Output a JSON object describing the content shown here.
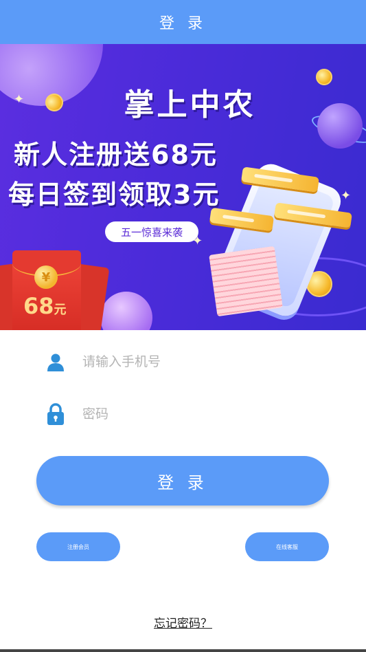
{
  "header": {
    "title": "登 录"
  },
  "banner": {
    "title": "掌上中农",
    "line1": "新人注册送68元",
    "line2": "每日签到领取3元",
    "tag": "五一惊喜来袭",
    "envelope_symbol": "¥",
    "envelope_amount": "68",
    "envelope_unit": "元"
  },
  "form": {
    "phone_placeholder": "请输入手机号",
    "password_placeholder": "密码",
    "phone_icon": "user-icon",
    "password_icon": "lock-icon"
  },
  "buttons": {
    "login": "登 录",
    "register": "注册会员",
    "service": "在线客服"
  },
  "links": {
    "forgot": "忘记密码？"
  },
  "colors": {
    "primary": "#5b9bf8",
    "icon_blue": "#2f8fd8",
    "banner_bg": "#4b2bd9"
  }
}
